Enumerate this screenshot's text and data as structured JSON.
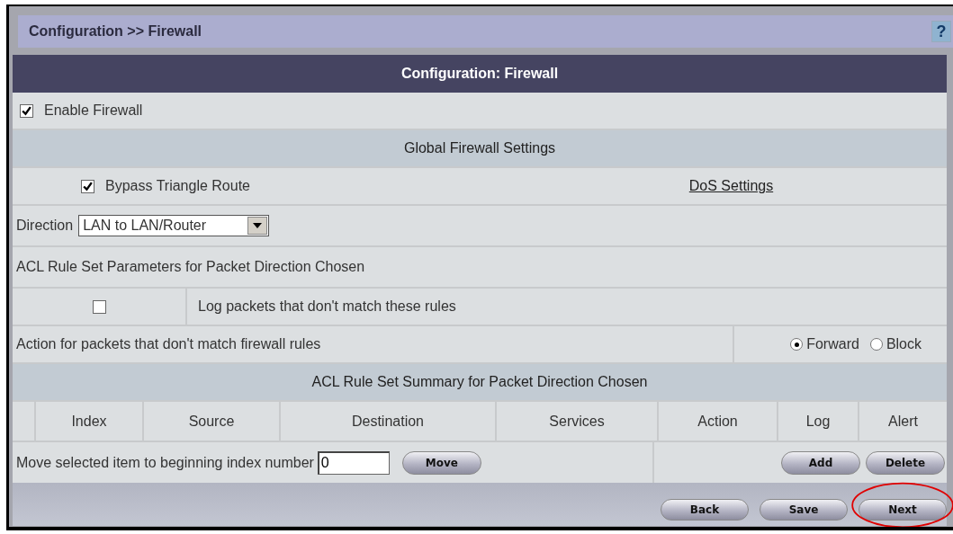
{
  "breadcrumb": "Configuration >> Firewall",
  "help": "?",
  "title": "Configuration: Firewall",
  "enable_firewall": {
    "label": "Enable Firewall",
    "checked": true
  },
  "global_section": "Global Firewall Settings",
  "bypass": {
    "label": "Bypass Triangle Route",
    "checked": true
  },
  "dos_link": "DoS Settings",
  "direction": {
    "label": "Direction",
    "value": "LAN to LAN/Router"
  },
  "acl_params_heading": "ACL Rule Set Parameters for Packet Direction Chosen",
  "log_packets": {
    "label": "Log packets that don't match these rules",
    "checked": false
  },
  "action": {
    "label": "Action for packets that don't match firewall rules",
    "options": [
      {
        "label": "Forward",
        "selected": true
      },
      {
        "label": "Block",
        "selected": false
      }
    ]
  },
  "summary_heading": "ACL Rule Set Summary for Packet Direction Chosen",
  "table": {
    "columns": [
      "Index",
      "Source",
      "Destination",
      "Services",
      "Action",
      "Log",
      "Alert"
    ]
  },
  "move": {
    "label": "Move selected item to beginning index number",
    "value": "0",
    "button": "Move"
  },
  "row_buttons": [
    "Add",
    "Delete"
  ],
  "footer_buttons": [
    {
      "label": "Back",
      "highlighted": false
    },
    {
      "label": "Save",
      "highlighted": false
    },
    {
      "label": "Next",
      "highlighted": true
    }
  ]
}
